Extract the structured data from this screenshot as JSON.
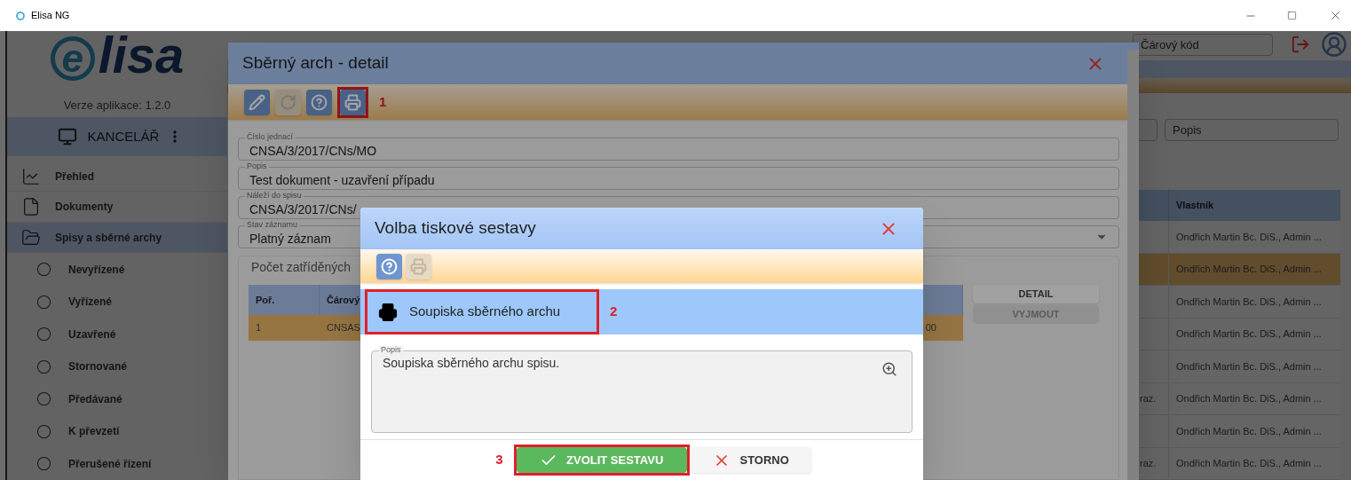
{
  "window": {
    "title": "Elisa NG"
  },
  "sidebar": {
    "logo": {
      "mark": "e",
      "text": "lisa"
    },
    "version": "Verze aplikace: 1.2.0",
    "workspace": "KANCELÁŘ",
    "items": [
      {
        "label": "Přehled",
        "kind": "chart",
        "selected": false
      },
      {
        "label": "Dokumenty",
        "kind": "document",
        "selected": false
      },
      {
        "label": "Spisy a sběrné archy",
        "kind": "folder",
        "selected": true,
        "expanded": true,
        "children": [
          {
            "label": "Nevyřízené",
            "selected": false
          },
          {
            "label": "Vyřízené",
            "selected": false
          },
          {
            "label": "Uzavřené",
            "selected": false
          },
          {
            "label": "Stornované",
            "selected": false
          },
          {
            "label": "Předávané",
            "selected": false
          },
          {
            "label": "K převzetí",
            "selected": false
          },
          {
            "label": "Přerušené řízení",
            "selected": false
          }
        ]
      }
    ]
  },
  "header": {
    "barcode_field": {
      "placeholder": "Čárový kód"
    }
  },
  "filters": [
    {
      "placeholder": "Popis"
    }
  ],
  "list": {
    "columns": [
      "Vlastník"
    ],
    "rows": [
      {
        "note": "",
        "owner": "Ondřich Martin Bc. DiS., Admin ...",
        "selected": false
      },
      {
        "note": "",
        "owner": "Ondřich Martin Bc. DiS., Admin ...",
        "selected": true
      },
      {
        "note": "",
        "owner": "Ondřich Martin Bc. DiS., Admin ...",
        "selected": false
      },
      {
        "note": "",
        "owner": "Ondřich Martin Bc. DiS., Admin ...",
        "selected": false
      },
      {
        "note": "",
        "owner": "Ondřich Martin Bc. DiS., Admin ...",
        "selected": false
      },
      {
        "note": "raz.",
        "owner": "Ondřich Martin Bc. DiS., Admin ...",
        "selected": false
      },
      {
        "note": "",
        "owner": "Ondřich Martin Bc. DiS., Admin ...",
        "selected": false
      },
      {
        "note": "raz.",
        "owner": "Ondřich Martin Bc. DiS., Admin ...",
        "selected": false
      }
    ]
  },
  "detail": {
    "title": "Sběrný arch - detail",
    "toolbar": [
      {
        "kind": "edit",
        "disabled": false
      },
      {
        "kind": "refresh",
        "disabled": true
      },
      {
        "kind": "help",
        "disabled": false
      },
      {
        "kind": "print",
        "disabled": false,
        "callout": "1"
      }
    ],
    "fields": [
      {
        "label": "Číslo jednací",
        "value": "CNSA/3/2017/CNs/MO",
        "kind": "text"
      },
      {
        "label": "Popis",
        "value": "Test dokument - uzavření případu",
        "kind": "text"
      },
      {
        "label": "Náleží do spisu",
        "value": "CNSA/3/2017/CNs/",
        "kind": "text"
      },
      {
        "label": "Stav záznamu",
        "value": "Platný záznam",
        "kind": "select"
      }
    ],
    "panel": {
      "title": "Počet zatříděných",
      "columns": [
        "Poř.",
        "Čárový"
      ],
      "rows": [
        {
          "cells": [
            "1",
            "CNSAS"
          ],
          "tail": "00",
          "selected": true
        }
      ],
      "buttons": [
        {
          "label": "DETAIL",
          "disabled": false
        },
        {
          "label": "VYJMOUT",
          "disabled": true
        }
      ]
    }
  },
  "print_dialog": {
    "title": "Volba tiskové sestavy",
    "toolbar": [
      {
        "kind": "help",
        "disabled": false
      },
      {
        "kind": "print",
        "disabled": true
      }
    ],
    "reports": [
      {
        "label": "Soupiska sběrného archu",
        "selected": true,
        "callout": "2"
      }
    ],
    "description": {
      "label": "Popis",
      "value": "Soupiska sběrného archu spisu."
    },
    "buttons": [
      {
        "label": "ZVOLIT SESTAVU",
        "kind": "confirm",
        "callout": "3"
      },
      {
        "label": "STORNO",
        "kind": "cancel"
      }
    ]
  }
}
